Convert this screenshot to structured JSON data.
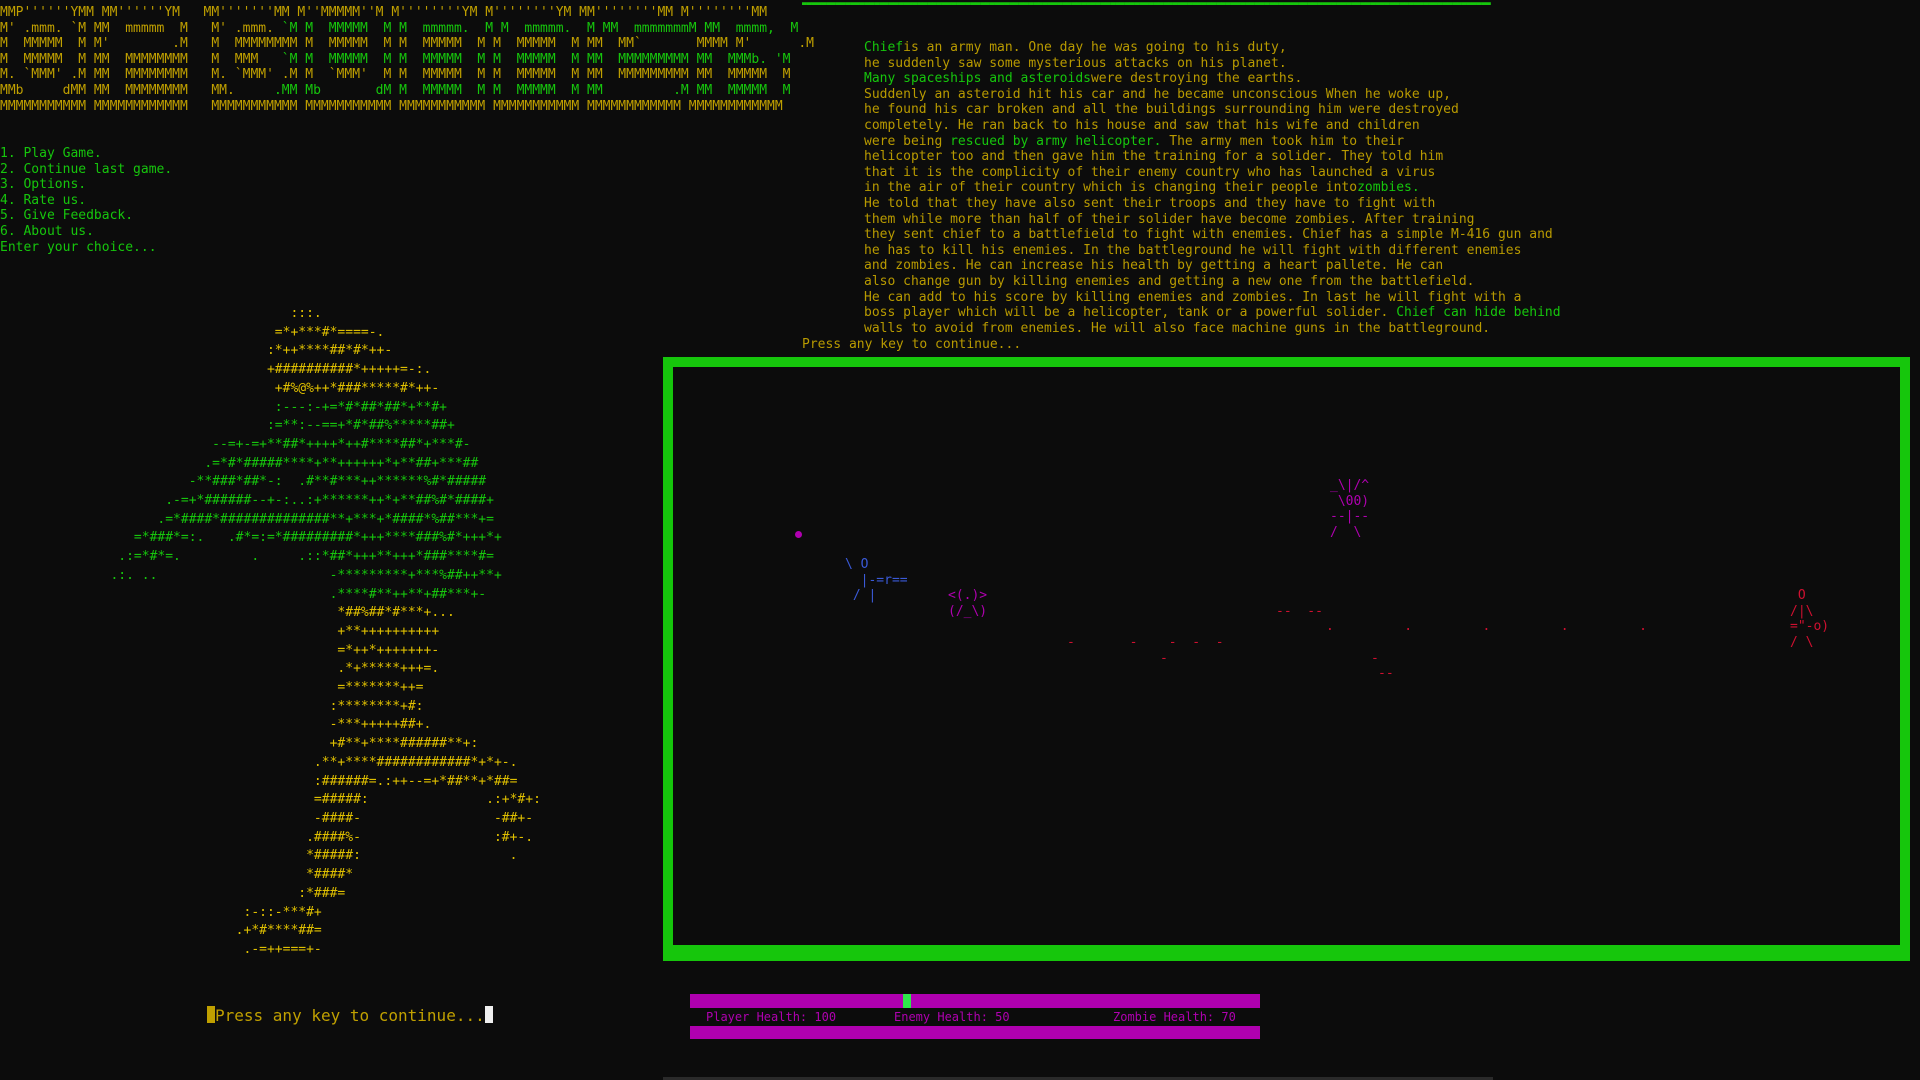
{
  "banner": {
    "lines": [
      "MMP''''''YMM MM''''''YM   MM'''''''MM M''MMMMM''M M''''''''YM M''''''''YM MM''''''''MM M''''''''MM",
      "M' .mmm. `M MM  mmmmm  M   M' .mmm. `M M  MMMMM  M M  mmmmm.  M M  mmmmm.  M MM  mmmmmmmM MM  mmmm,  M",
      "M  MMMMM  M M'        .M   M  MMMMMMMM M  MMMMM  M M  MMMMM  M M  MMMMM  M MM  MM`       MMMM M'      .M",
      "M  MMMMM  M MM  MMMMMMMM   M  MMM   `M M  MMMMM  M M  MMMMM  M M  MMMMM  M MM  MMMMMMMMM MM  MMMb. 'M",
      "M. `MMM' .M MM  MMMMMMMM   M. `MMM' .M M  `MMM'  M M  MMMMM  M M  MMMMM  M MM  MMMMMMMMM MM  MMMMM  M",
      "MMb     dMM MM  MMMMMMMM   MM.     .MM Mb       dM M  MMMMM  M M  MMMMM  M MM         .M MM  MMMMM  M",
      "MMMMMMMMMMM MMMMMMMMMMMM   MMMMMMMMMMM MMMMMMMMMMM MMMMMMMMMMM MMMMMMMMMMM MMMMMMMMMMMM MMMMMMMMMMMM"
    ]
  },
  "menu": {
    "items": [
      "1. Play Game.",
      "2. Continue last game.",
      "3. Options.",
      "4. Rate us.",
      "5. Give Feedback.",
      "6. About us."
    ],
    "prompt": "Enter your choice..."
  },
  "soldier_art": [
    "                                :::.",
    "                              =*+***#*====-.",
    "                             :*++****##*#*++-",
    "                             +##########*+++++=-:.",
    "                              +#%@%++*###*****#*++-",
    "                              :---:-+=*#*##*##*+**#+",
    "                             :=**:--==+*#*##%*****##+",
    "                      --=+-=+**##*++++*++#****##*+***#-",
    "                     .=*#*#####****+**++++++*+**##+***##",
    "                   -**###*##*-:  .#**#***++******%#*#####",
    "                .-=+*######--+-:..:+******++*+**##%#*####+",
    "               .=*####*##############**+***+*####*%##***+=",
    "            =*###*=:.   .#*=:=*#########*+++****###%#*+++*+",
    "          .:=*#*=.         .     .::*##*+++**+++*###****#=",
    "         .:. ..                      -*********+***%##++**+",
    "                                     .****#**++**+##***+-",
    "                                      *##%##*#***+...",
    "                                      +**++++++++++",
    "                                      =*++*+++++++-",
    "                                      .*+*****+++=.",
    "                                      =*******++=",
    "                                     :********+#:",
    "                                     -***+++++##+.",
    "                                     +#**+****######**+:",
    "                                   .**+****############*+*+-.",
    "                                   :######=.:++--=+*##**+*##=",
    "                                   =#####:               .:+*#+:",
    "                                   -####-                 -##+-",
    "                                  .####%-                 :#+-.",
    "                                  *#####:                   .",
    "                                  *####*",
    "                                 :*###=",
    "                          :-::-***#+",
    "                         .+*#****##=",
    "                          .-=++===+-"
  ],
  "story": {
    "lines": [
      [
        {
          "t": "Chief",
          "h": true
        },
        {
          "t": "is an army man. One day he was going to his duty,",
          "h": false
        }
      ],
      [
        {
          "t": "he suddenly saw some mysterious attacks on his planet.",
          "h": false
        }
      ],
      [
        {
          "t": "Many spaceships and asteroids",
          "h": true
        },
        {
          "t": "were destroying the earths.",
          "h": false
        }
      ],
      [
        {
          "t": "Suddenly an asteroid hit his car and he became unconscious When he woke up,",
          "h": false
        }
      ],
      [
        {
          "t": "he found his car broken and all the buildings surrounding him were destroyed",
          "h": false
        }
      ],
      [
        {
          "t": "completely. He ran back to his house and saw that his wife and children",
          "h": false
        }
      ],
      [
        {
          "t": "were being ",
          "h": false
        },
        {
          "t": "rescued by army helicopter.",
          "h": true
        },
        {
          "t": " The army men took him to their",
          "h": false
        }
      ],
      [
        {
          "t": "helicopter too and then gave him the training for a solider. They told him",
          "h": false
        }
      ],
      [
        {
          "t": "that it is the complicity of their enemy country who has launched a virus",
          "h": false
        }
      ],
      [
        {
          "t": "in the air of their country which is changing their people into",
          "h": false
        },
        {
          "t": "zombies.",
          "h": true
        }
      ],
      [
        {
          "t": "He told that they have also sent their troops and they have to fight with",
          "h": false
        }
      ],
      [
        {
          "t": "them while more than half of their solider have become zombies. After training",
          "h": false
        }
      ],
      [
        {
          "t": "they sent chief to a battlefield to fight with enemies. Chief has a simple M-416 gun and",
          "h": false
        }
      ],
      [
        {
          "t": "he has to kill his enemies. In the battleground he will fight with different enemies",
          "h": false
        }
      ],
      [
        {
          "t": "and zombies. He can increase his health by getting a heart pallete. He can",
          "h": false
        }
      ],
      [
        {
          "t": "also change gun by killing enemies and getting a new one from the battlefield.",
          "h": false
        }
      ],
      [
        {
          "t": "He can add to his score by killing enemies and zombies. In last he will fight with a",
          "h": false
        }
      ],
      [
        {
          "t": "boss player which will be a helicopter, tank or a powerful solider. ",
          "h": false
        },
        {
          "t": "Chief can hide behind",
          "h": true
        }
      ],
      [
        {
          "t": "walls to avoid from enemies. He will also face machine guns in the battleground.",
          "h": false
        }
      ]
    ]
  },
  "press_top": "Press any key to continue...",
  "press_bottom": "Press any key to continue...",
  "game": {
    "player_sprite": "\\ O\n  |-=r==\n / |",
    "heli_sprite": "_\\|/^\n \\00)\n--|--\n/  \\",
    "zombie_sprite": "<(.)>\n(/_\\)",
    "enemy_sprite": " O\n/|\\\n=\"-o)\n/ \\",
    "debris": [
      {
        "t": "--  --",
        "c": "#d01030"
      },
      {
        "t": "-       -    -  -  -",
        "c": "#d01030"
      },
      {
        "t": "-",
        "c": "#d01030"
      },
      {
        "t": ".         .         .         .         .",
        "c": "#d01030"
      },
      {
        "t": "-",
        "c": "#d01030"
      },
      {
        "t": "--",
        "c": "#d01030"
      }
    ]
  },
  "hud": {
    "player_health": "Player Health: 100",
    "enemy_health": "Enemy Health: 50",
    "zombie_health": "Zombie Health: 70",
    "progress_fraction": 0.38
  },
  "colors": {
    "terminal_green": "#16c60c",
    "terminal_yellow": "#b89a00",
    "magenta": "#b000b0",
    "blue": "#3a5ad8",
    "red": "#d01030"
  }
}
